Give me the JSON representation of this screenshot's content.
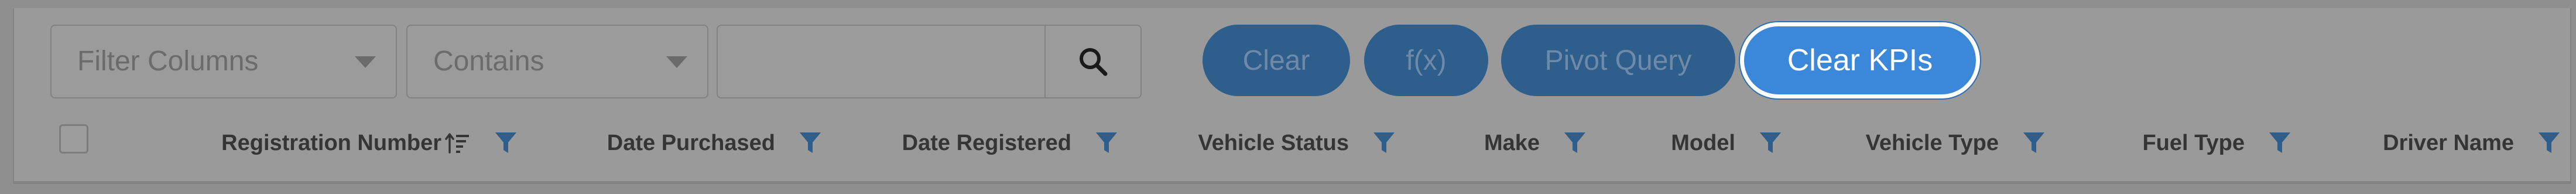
{
  "toolbar": {
    "filter_columns": {
      "label": "Filter Columns",
      "icon": "chevron-down-icon"
    },
    "condition": {
      "label": "Contains",
      "icon": "chevron-down-icon"
    },
    "search": {
      "value": "",
      "placeholder": "",
      "icon": "search-icon"
    },
    "buttons": {
      "clear": "Clear",
      "fx": "f(x)",
      "pivot_query": "Pivot Query",
      "clear_kpis": "Clear KPIs"
    }
  },
  "colors": {
    "primary_button": "#2d5e8c",
    "active_button": "#3b87d9",
    "filter_icon": "#2d5e8c",
    "overlay": "#8f8f8f"
  },
  "grid": {
    "select_all_checked": false,
    "columns": [
      {
        "label": "Registration Number",
        "sorted": true,
        "sort_icon": "sort-ascending-icon",
        "filter_icon": "filter-icon"
      },
      {
        "label": "Date Purchased",
        "filter_icon": "filter-icon"
      },
      {
        "label": "Date Registered",
        "filter_icon": "filter-icon"
      },
      {
        "label": "Vehicle Status",
        "filter_icon": "filter-icon"
      },
      {
        "label": "Make",
        "filter_icon": "filter-icon"
      },
      {
        "label": "Model",
        "filter_icon": "filter-icon"
      },
      {
        "label": "Vehicle Type",
        "filter_icon": "filter-icon"
      },
      {
        "label": "Fuel Type",
        "filter_icon": "filter-icon"
      },
      {
        "label": "Driver Name",
        "filter_icon": "filter-icon"
      }
    ]
  }
}
